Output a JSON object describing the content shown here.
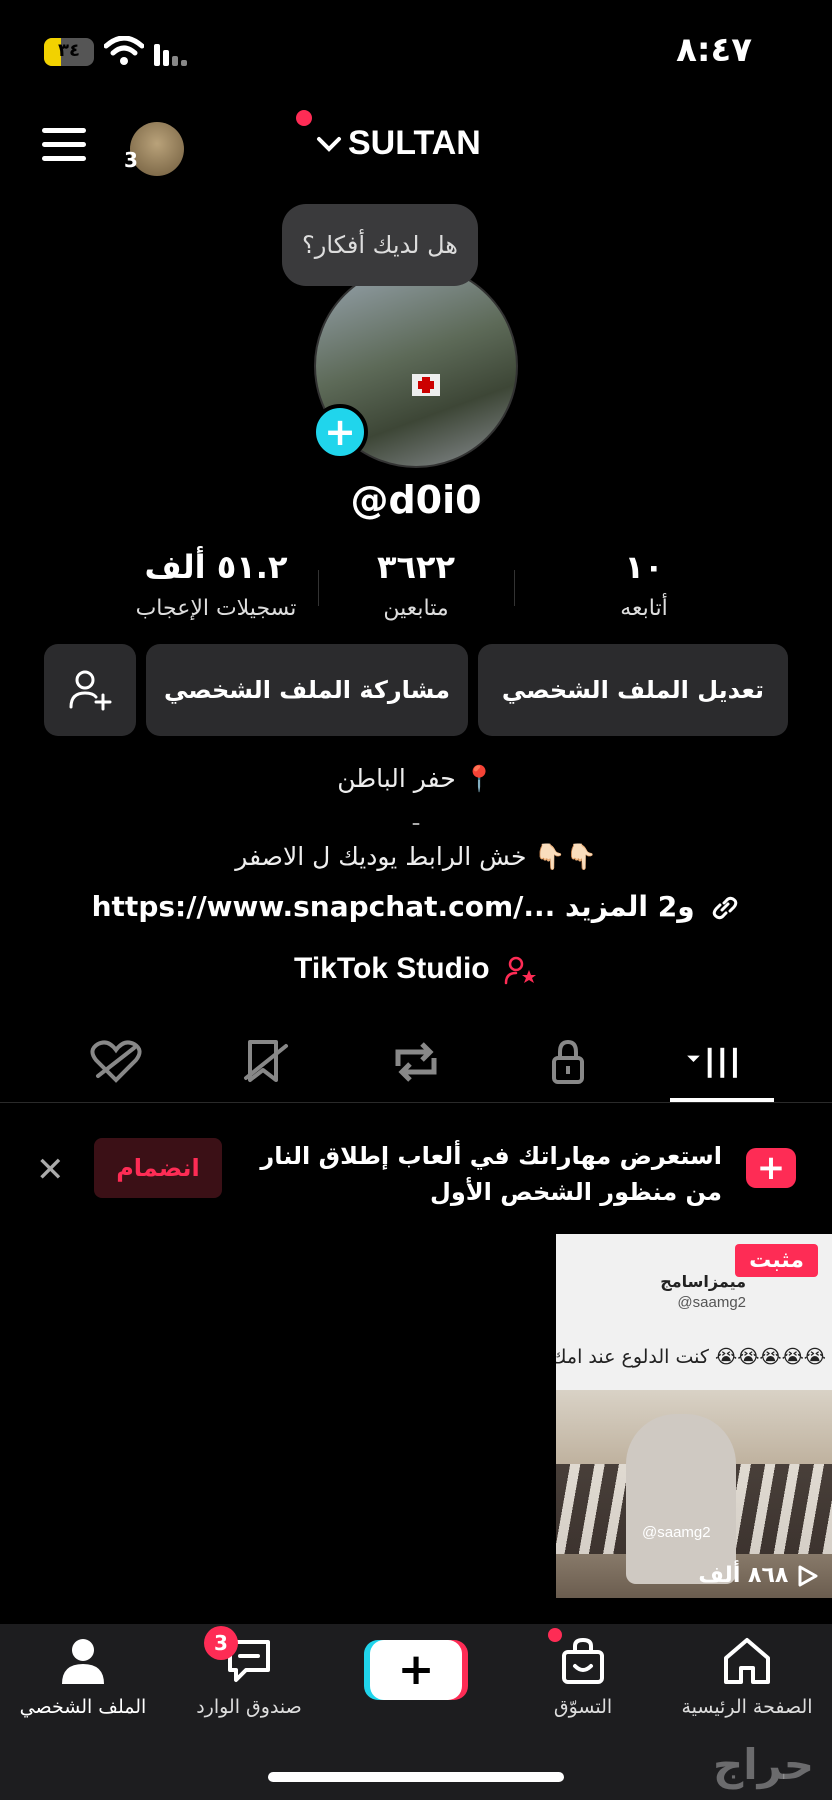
{
  "status_bar": {
    "time": "٨:٤٧",
    "battery": "٣٤",
    "battery_level": 0.34
  },
  "header": {
    "username": "SULTAN",
    "account_badge": "3"
  },
  "profile": {
    "bubble_text": "هل لديك أفكار؟",
    "handle": "@d0i0",
    "stats": [
      {
        "value": "١٠",
        "label": "أتابعه"
      },
      {
        "value": "٣٦٢٢",
        "label": "متابعين"
      },
      {
        "value": "٥١.٢ ألف",
        "label": "تسجيلات الإعجاب"
      }
    ],
    "buttons": {
      "edit": "تعديل الملف الشخصي",
      "share": "مشاركة الملف الشخصي"
    },
    "bio": [
      "حفر الباطن 📍",
      "-",
      "خش الرابط يوديك ل الاصفر 👇🏻👇🏻"
    ],
    "link": "https://www.snapchat.com/... و2 المزيد",
    "studio": "TikTok Studio"
  },
  "promo": {
    "text": "استعرض مهاراتك في ألعاب إطلاق النار من منظور الشخص الأول",
    "join": "انضمام"
  },
  "video": {
    "pinned": "مثبت",
    "name": "ميمزاسامج",
    "user": "@saamg2",
    "caption": "كنت الدلوع عند امك 😭😭😭😭😭",
    "ig_tag": "@saamg2",
    "views": "٨٦٨ ألف"
  },
  "nav": {
    "items": [
      {
        "label": "الصفحة الرئيسية"
      },
      {
        "label": "التسوّق"
      },
      {
        "label": "صندوق الوارد"
      },
      {
        "label": "الملف الشخصي"
      }
    ],
    "inbox_badge": "3"
  },
  "watermark": "حراج"
}
